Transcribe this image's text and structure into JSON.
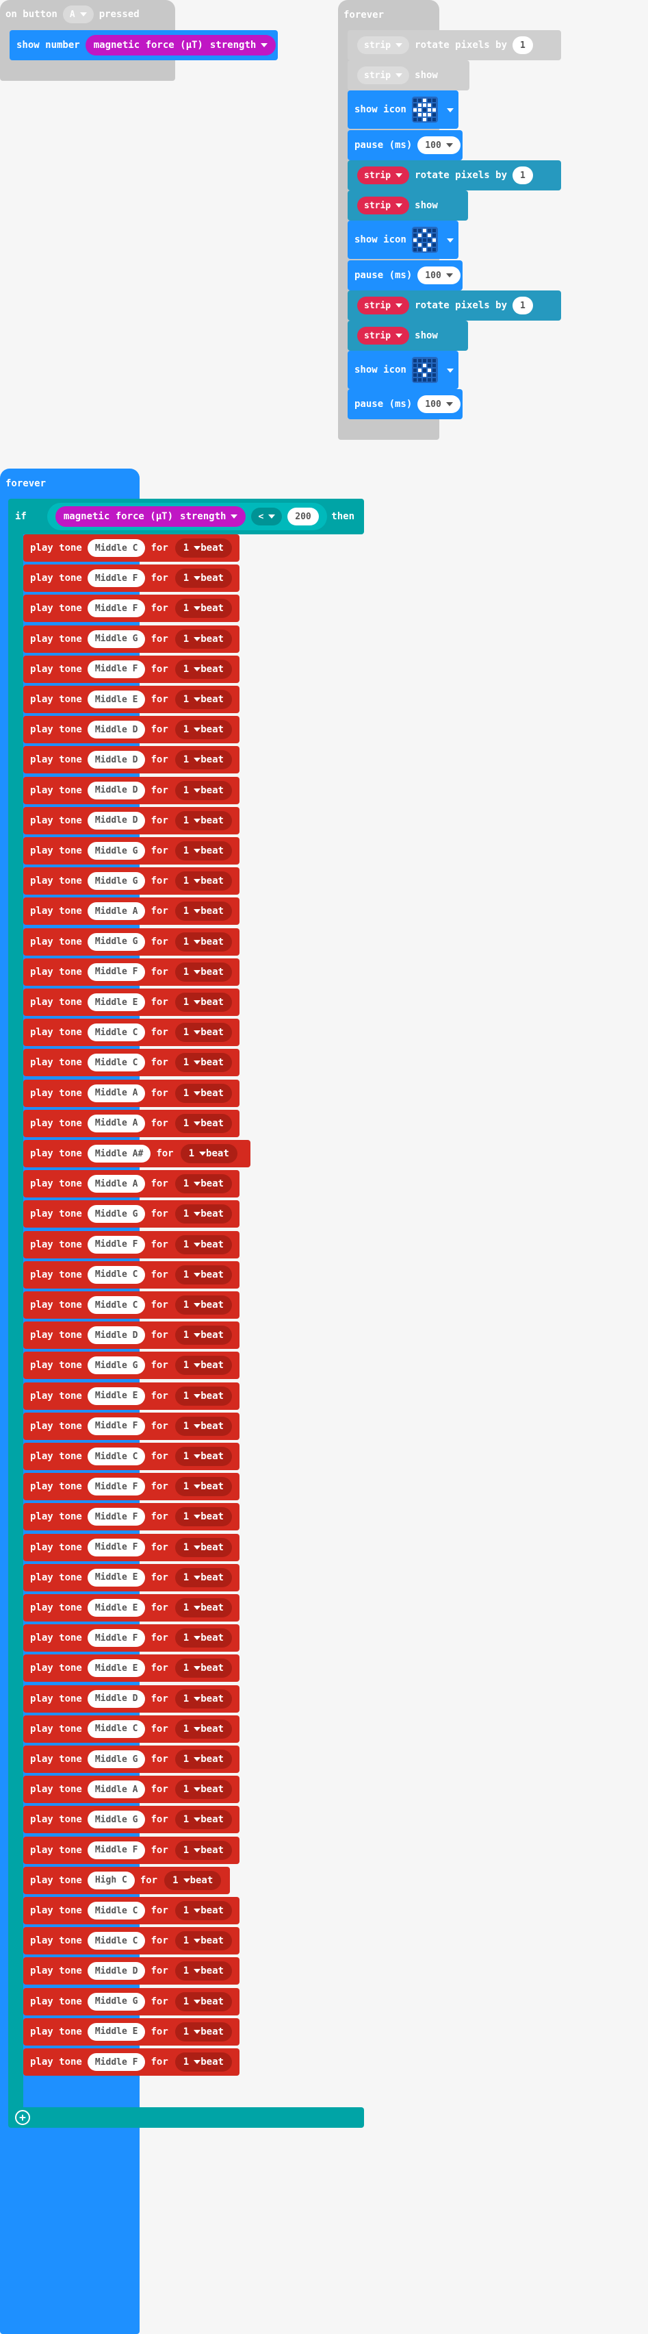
{
  "on_button_block": {
    "label_pre": "on button",
    "button_value": "A",
    "label_post": "pressed",
    "show_number_label": "show number",
    "reporter_text": "magnetic force (µT)",
    "reporter_option": "strength"
  },
  "forever_top": {
    "title": "forever",
    "blocks": [
      {
        "kind": "rotate",
        "disabled": true,
        "strip": "strip",
        "text": "rotate pixels by",
        "value": "1"
      },
      {
        "kind": "show",
        "disabled": true,
        "strip": "strip",
        "text": "show"
      },
      {
        "kind": "icon",
        "label": "show icon",
        "icon": "large-diamond"
      },
      {
        "kind": "pause",
        "label": "pause (ms)",
        "value": "100"
      },
      {
        "kind": "rotate",
        "disabled": false,
        "strip": "strip",
        "text": "rotate pixels by",
        "value": "1"
      },
      {
        "kind": "show",
        "disabled": false,
        "strip": "strip",
        "text": "show"
      },
      {
        "kind": "icon",
        "label": "show icon",
        "icon": "small-diamond-outline"
      },
      {
        "kind": "pause",
        "label": "pause (ms)",
        "value": "100"
      },
      {
        "kind": "rotate",
        "disabled": false,
        "strip": "strip",
        "text": "rotate pixels by",
        "value": "1"
      },
      {
        "kind": "show",
        "disabled": false,
        "strip": "strip",
        "text": "show"
      },
      {
        "kind": "icon",
        "label": "show icon",
        "icon": "small-diamond"
      },
      {
        "kind": "pause",
        "label": "pause (ms)",
        "value": "100"
      }
    ]
  },
  "forever_main": {
    "title": "forever",
    "if_label": "if",
    "then_label": "then",
    "condition_reporter": "magnetic force (µT)",
    "condition_option": "strength",
    "operator": "<",
    "threshold": "200",
    "tone_prefix": "play tone",
    "for_label": "for",
    "beat_value": "1",
    "beat_label": "beat",
    "notes": [
      "Middle C",
      "Middle F",
      "Middle F",
      "Middle G",
      "Middle F",
      "Middle E",
      "Middle D",
      "Middle D",
      "Middle D",
      "Middle D",
      "Middle G",
      "Middle G",
      "Middle A",
      "Middle G",
      "Middle F",
      "Middle E",
      "Middle C",
      "Middle C",
      "Middle A",
      "Middle A",
      "Middle A#",
      "Middle A",
      "Middle G",
      "Middle F",
      "Middle C",
      "Middle C",
      "Middle D",
      "Middle G",
      "Middle E",
      "Middle F",
      "Middle C",
      "Middle F",
      "Middle F",
      "Middle F",
      "Middle E",
      "Middle E",
      "Middle F",
      "Middle E",
      "Middle D",
      "Middle C",
      "Middle G",
      "Middle A",
      "Middle G",
      "Middle F",
      "High C",
      "Middle C",
      "Middle C",
      "Middle D",
      "Middle G",
      "Middle E",
      "Middle F"
    ]
  },
  "colors": {
    "basic_blue": "#1e90ff",
    "neopixel": "#2699bf",
    "strip_red": "#e0284f",
    "input_magenta": "#c017c4",
    "logic_teal": "#00a4a6",
    "music_red": "#d42a1f",
    "disabled_grey": "#cccccc"
  }
}
